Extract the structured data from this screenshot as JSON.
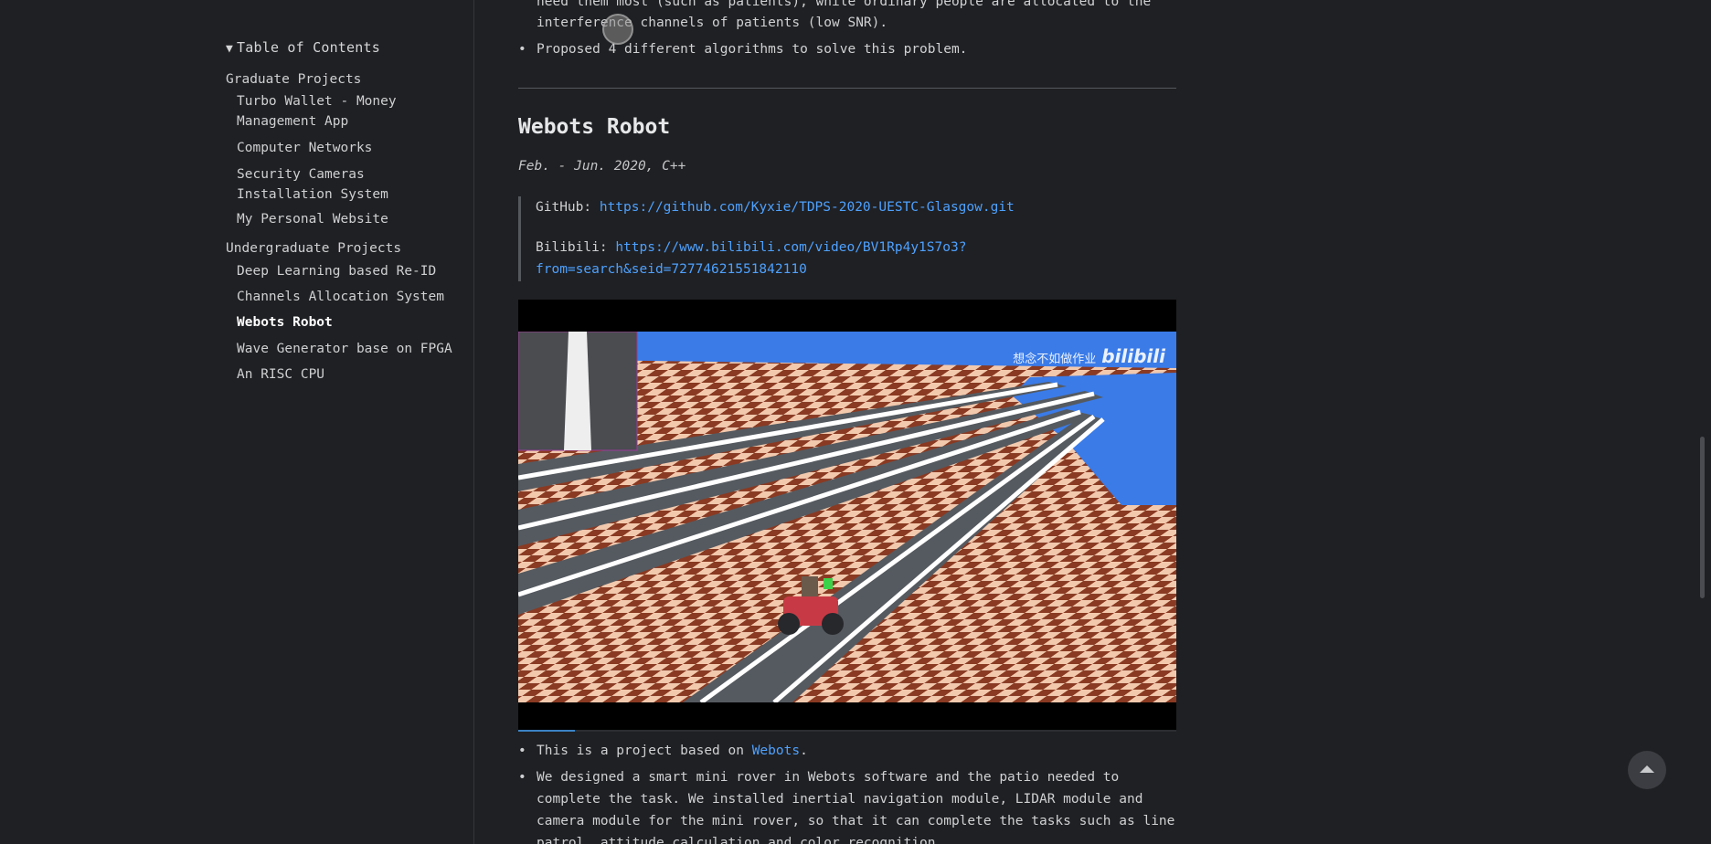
{
  "toc": {
    "title": "Table of Contents",
    "groups": [
      {
        "label": "Graduate Projects",
        "items": [
          "Turbo Wallet - Money Management App",
          "Computer Networks",
          "Security Cameras Installation System",
          "My Personal Website"
        ]
      },
      {
        "label": "Undergraduate Projects",
        "items": [
          "Deep Learning based Re-ID",
          "Channels Allocation System",
          "Webots Robot",
          "Wave Generator base on FPGA",
          "An RISC CPU"
        ]
      }
    ],
    "active_item": "Webots Robot"
  },
  "top_text": {
    "line1": "need them most (such as patients), while ordinary people are allocated to the",
    "line2": "interference channels of patients (low SNR).",
    "bullet": "Proposed 4 different algorithms to solve this problem."
  },
  "section": {
    "title": "Webots Robot",
    "meta": "Feb. - Jun. 2020, C++",
    "github_label": "GitHub:",
    "github_url": "https://github.com/Kyxie/TDPS-2020-UESTC-Glasgow.git",
    "bilibili_label": "Bilibili:",
    "bilibili_url_line1": "https://www.bilibili.com/video/BV1Rp4y1S7o3?",
    "bilibili_url_line2": "from=search&seid=72774621551842110"
  },
  "video": {
    "watermark_text": "想念不如做作业",
    "watermark_brand": "bilibili",
    "progress": 0.086
  },
  "bullets": {
    "b1_prefix": "This is a project based on ",
    "b1_link": "Webots",
    "b1_suffix": ".",
    "b2_line1": "We designed a smart mini rover in Webots software and the patio needed to",
    "b2_line2": "complete the task. We installed inertial navigation module, LIDAR module and",
    "b2_line3": "camera module for the mini rover, so that it can complete the tasks such as line",
    "b2_line4": "patrol, attitude calculation and color recognition."
  },
  "colors": {
    "background": "#1f2023",
    "link": "#4ea1ff",
    "text": "#d0d1d3"
  },
  "icons": {
    "back_to_top": "arrow-up-icon",
    "toc_toggle": "triangle-down-icon"
  }
}
